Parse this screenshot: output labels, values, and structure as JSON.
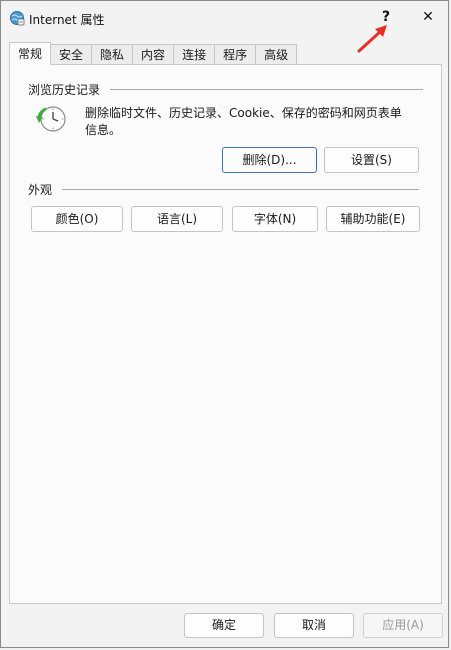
{
  "window": {
    "title": "Internet 属性",
    "help_label": "?",
    "close_label": "✕"
  },
  "tabs": [
    {
      "label": "常规",
      "active": true
    },
    {
      "label": "安全"
    },
    {
      "label": "隐私"
    },
    {
      "label": "内容"
    },
    {
      "label": "连接"
    },
    {
      "label": "程序"
    },
    {
      "label": "高级"
    }
  ],
  "history": {
    "group_label": "浏览历史记录",
    "description": "删除临时文件、历史记录、Cookie、保存的密码和网页表单信息。",
    "delete_label": "删除(D)...",
    "settings_label": "设置(S)"
  },
  "appearance": {
    "group_label": "外观",
    "colors_label": "颜色(O)",
    "languages_label": "语言(L)",
    "fonts_label": "字体(N)",
    "accessibility_label": "辅助功能(E)"
  },
  "footer": {
    "ok_label": "确定",
    "cancel_label": "取消",
    "apply_label": "应用(A)"
  },
  "colors": {
    "annotation_arrow": "#e8312a",
    "default_button_border": "#3d6fb5"
  },
  "icons": {
    "title": "internet-options-icon",
    "history": "clock-refresh-icon"
  }
}
